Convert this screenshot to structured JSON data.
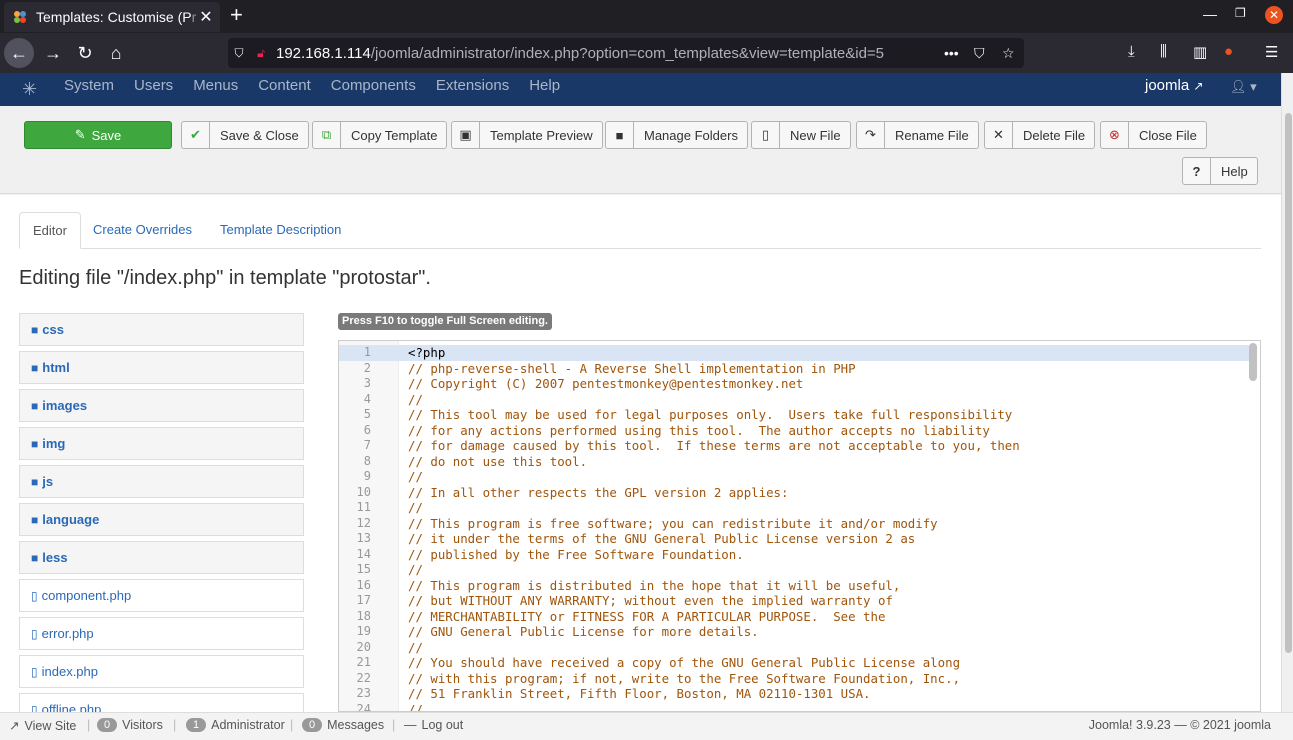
{
  "browser": {
    "tab_title": "Templates: Customise (P",
    "tab_title_dim": "r",
    "new_tab": "+",
    "url_host": "192.168.1.114",
    "url_path": "/joomla/administrator/index.php?option=com_templates&view=template&id=5",
    "url_more": "•••"
  },
  "joomla": {
    "menu": [
      "System",
      "Users",
      "Menus",
      "Content",
      "Components",
      "Extensions",
      "Help"
    ],
    "user_link": "joomla"
  },
  "toolbar": {
    "save": "Save",
    "save_close": "Save & Close",
    "copy_template": "Copy Template",
    "template_preview": "Template Preview",
    "manage_folders": "Manage Folders",
    "new_file": "New File",
    "rename_file": "Rename File",
    "delete_file": "Delete File",
    "close_file": "Close File",
    "help": "Help"
  },
  "tabs": {
    "editor": "Editor",
    "create_overrides": "Create Overrides",
    "template_description": "Template Description"
  },
  "heading": "Editing file \"/index.php\" in template \"protostar\".",
  "folders": [
    "css",
    "html",
    "images",
    "img",
    "js",
    "language",
    "less"
  ],
  "files": [
    "component.php",
    "error.php",
    "index.php",
    "offline.php"
  ],
  "f10_label": "Press F10 to toggle Full Screen editing.",
  "code_lines": [
    "<?php",
    "// php-reverse-shell - A Reverse Shell implementation in PHP",
    "// Copyright (C) 2007 pentestmonkey@pentestmonkey.net",
    "//",
    "// This tool may be used for legal purposes only.  Users take full responsibility",
    "// for any actions performed using this tool.  The author accepts no liability",
    "// for damage caused by this tool.  If these terms are not acceptable to you, then",
    "// do not use this tool.",
    "//",
    "// In all other respects the GPL version 2 applies:",
    "//",
    "// This program is free software; you can redistribute it and/or modify",
    "// it under the terms of the GNU General Public License version 2 as",
    "// published by the Free Software Foundation.",
    "//",
    "// This program is distributed in the hope that it will be useful,",
    "// but WITHOUT ANY WARRANTY; without even the implied warranty of",
    "// MERCHANTABILITY or FITNESS FOR A PARTICULAR PURPOSE.  See the",
    "// GNU General Public License for more details.",
    "//",
    "// You should have received a copy of the GNU General Public License along",
    "// with this program; if not, write to the Free Software Foundation, Inc.,",
    "// 51 Franklin Street, Fifth Floor, Boston, MA 02110-1301 USA.",
    "//"
  ],
  "statusbar": {
    "view_site": "View Site",
    "visitors_count": "0",
    "visitors": "Visitors",
    "admin_count": "1",
    "administrator": "Administrator",
    "messages_count": "0",
    "messages": "Messages",
    "log_out": "Log out",
    "footer": "Joomla! 3.9.23  —  © 2021 joomla"
  }
}
